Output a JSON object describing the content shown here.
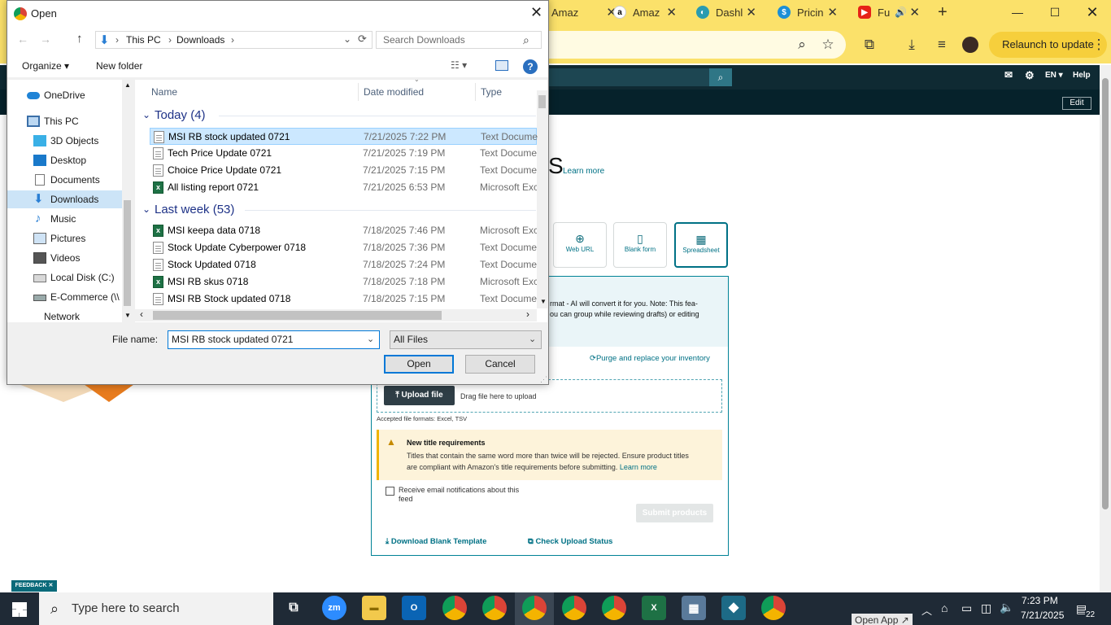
{
  "browser": {
    "tabs": [
      {
        "label": "Amaz"
      },
      {
        "label": "Amaz"
      },
      {
        "label": "Dashl"
      },
      {
        "label": "Pricin"
      },
      {
        "label": "Fu"
      }
    ],
    "relaunch_label": "Relaunch to update",
    "new_tab": "+"
  },
  "amazon": {
    "lang": "EN",
    "help": "Help",
    "edit": "Edit",
    "heading_fragment": "S",
    "learn_more": "Learn more",
    "cards": [
      {
        "label": "Web URL"
      },
      {
        "label": "Blank form"
      },
      {
        "label": "Spreadsheet"
      }
    ],
    "info_line1": "rmat - AI will convert it for you. Note: This fea-",
    "info_line2": "ou can group while reviewing drafts) or editing",
    "purge_link": "Purge and replace your inventory",
    "upload_btn": "Upload file",
    "drag_text": "Drag file here to upload",
    "accepted": "Accepted file formats: Excel, TSV",
    "alert_title": "New title requirements",
    "alert_body1": "Titles that contain the same word more than twice will be rejected. Ensure product titles",
    "alert_body2": "are compliant with Amazon's title requirements before submitting.",
    "alert_link": "Learn more",
    "notify_label1": "Receive email notifications about this",
    "notify_label2": "feed",
    "submit": "Submit products",
    "download_template": "Download Blank Template",
    "check_status": "Check Upload Status",
    "feedback": "FEEDBACK"
  },
  "dialog": {
    "title": "Open",
    "breadcrumb": [
      "This PC",
      "Downloads"
    ],
    "search_placeholder": "Search Downloads",
    "organize": "Organize",
    "new_folder": "New folder",
    "nav": [
      {
        "label": "OneDrive"
      },
      {
        "label": "This PC"
      },
      {
        "label": "3D Objects"
      },
      {
        "label": "Desktop"
      },
      {
        "label": "Documents"
      },
      {
        "label": "Downloads"
      },
      {
        "label": "Music"
      },
      {
        "label": "Pictures"
      },
      {
        "label": "Videos"
      },
      {
        "label": "Local Disk (C:)"
      },
      {
        "label": "E-Commerce (\\\\"
      },
      {
        "label": "Network"
      }
    ],
    "columns": {
      "name": "Name",
      "date": "Date modified",
      "type": "Type"
    },
    "groups": [
      {
        "label": "Today (4)"
      },
      {
        "label": "Last week (53)"
      }
    ],
    "files_today": [
      {
        "name": "MSI RB stock updated 0721",
        "date": "7/21/2025 7:22 PM",
        "type": "Text Document",
        "kind": "txt"
      },
      {
        "name": "Tech Price Update 0721",
        "date": "7/21/2025 7:19 PM",
        "type": "Text Document",
        "kind": "txt"
      },
      {
        "name": "Choice Price Update 0721",
        "date": "7/21/2025 7:15 PM",
        "type": "Text Document",
        "kind": "txt"
      },
      {
        "name": "All listing report 0721",
        "date": "7/21/2025 6:53 PM",
        "type": "Microsoft Excel",
        "kind": "xls"
      }
    ],
    "files_lastweek": [
      {
        "name": "MSI keepa data 0718",
        "date": "7/18/2025 7:46 PM",
        "type": "Microsoft Excel",
        "kind": "xls"
      },
      {
        "name": "Stock Update Cyberpower 0718",
        "date": "7/18/2025 7:36 PM",
        "type": "Text Document",
        "kind": "txt"
      },
      {
        "name": "Stock Updated 0718",
        "date": "7/18/2025 7:24 PM",
        "type": "Text Document",
        "kind": "txt"
      },
      {
        "name": "MSI RB skus 0718",
        "date": "7/18/2025 7:18 PM",
        "type": "Microsoft Excel",
        "kind": "xls"
      },
      {
        "name": "MSI RB Stock updated 0718",
        "date": "7/18/2025 7:15 PM",
        "type": "Text Document",
        "kind": "txt"
      }
    ],
    "file_name_label": "File name:",
    "file_name_value": "MSI RB stock updated 0721",
    "filter": "All Files",
    "open": "Open",
    "cancel": "Cancel"
  },
  "taskbar": {
    "search_placeholder": "Type here to search",
    "time": "7:23 PM",
    "date": "7/21/2025",
    "notifications": "22",
    "open_app": "Open App"
  }
}
